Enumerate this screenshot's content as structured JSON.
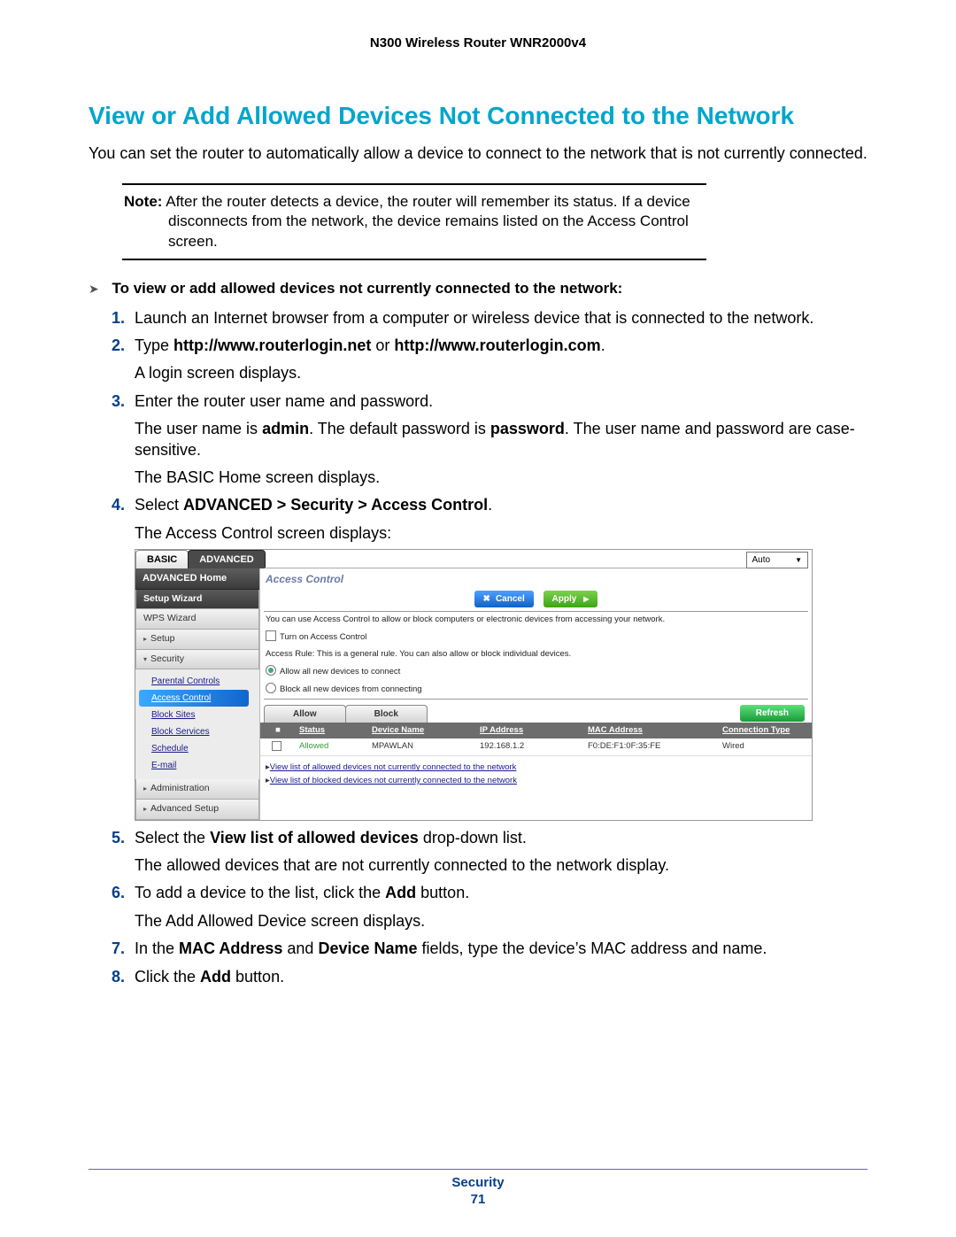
{
  "doc_header": "N300 Wireless Router WNR2000v4",
  "title": "View or Add Allowed Devices Not Connected to the Network",
  "intro": "You can set the router to automatically allow a device to connect to the network that is not currently connected.",
  "note": {
    "label": "Note:",
    "text": "After the router detects a device, the router will remember its status. If a device disconnects from the network, the device remains listed on the Access Control screen."
  },
  "procedure_title": "To view or add allowed devices not currently connected to the network:",
  "steps": {
    "s1": "Launch an Internet browser from a computer or wireless device that is connected to the network.",
    "s2_a": "Type ",
    "s2_b": "http://www.routerlogin.net",
    "s2_c": " or ",
    "s2_d": "http://www.routerlogin.com",
    "s2_e": ".",
    "s2_sub": "A login screen displays.",
    "s3": "Enter the router user name and password.",
    "s3_sub1": "The user name is admin. The default password is password. The user name and password are case-sensitive.",
    "s3_sub1_pre": "The user name is ",
    "s3_sub1_admin": "admin",
    "s3_sub1_mid": ". The default password is ",
    "s3_sub1_pw": "password",
    "s3_sub1_post": ". The user name and password are case-sensitive.",
    "s3_sub2": "The BASIC Home screen displays.",
    "s4_a": "Select ",
    "s4_b": "ADVANCED > Security > Access Control",
    "s4_c": ".",
    "s4_sub": "The Access Control screen displays:",
    "s5_a": "Select the ",
    "s5_b": "View list of allowed devices",
    "s5_c": " drop-down list.",
    "s5_sub": "The allowed devices that are not currently connected to the network display.",
    "s6_a": "To add a device to the list, click the ",
    "s6_b": "Add",
    "s6_c": " button.",
    "s6_sub": "The Add Allowed Device screen displays.",
    "s7_a": "In the ",
    "s7_b": "MAC Address",
    "s7_c": " and ",
    "s7_d": "Device Name",
    "s7_e": " fields, type the device’s MAC address and name.",
    "s8_a": "Click the ",
    "s8_b": "Add",
    "s8_c": " button."
  },
  "ui": {
    "tabs": {
      "basic": "BASIC",
      "advanced": "ADVANCED"
    },
    "lang": "Auto",
    "nav": {
      "adv_home": "ADVANCED Home",
      "setup_wizard": "Setup Wizard",
      "wps_wizard": "WPS Wizard",
      "setup": "Setup",
      "security": "Security",
      "security_items": {
        "parental": "Parental Controls",
        "access": "Access Control",
        "block_sites": "Block Sites",
        "block_services": "Block Services",
        "schedule": "Schedule",
        "email": "E-mail"
      },
      "administration": "Administration",
      "adv_setup": "Advanced Setup"
    },
    "panel": {
      "title": "Access Control",
      "cancel": "Cancel",
      "apply": "Apply",
      "desc": "You can use Access Control to allow or block computers or electronic devices from accessing your network.",
      "turn_on": "Turn on Access Control",
      "rule_label": "Access Rule: This is a general rule. You can also allow or block individual devices.",
      "allow_new": "Allow all new devices to connect",
      "block_new": "Block all new devices from connecting",
      "tab_allow": "Allow",
      "tab_block": "Block",
      "refresh": "Refresh",
      "cols": {
        "status": "Status",
        "name": "Device Name",
        "ip": "IP Address",
        "mac": "MAC Address",
        "conn": "Connection Type"
      },
      "row": {
        "status": "Allowed",
        "name": "MPAWLAN",
        "ip": "192.168.1.2",
        "mac": "F0:DE:F1:0F:35:FE",
        "conn": "Wired"
      },
      "link_allowed": "View list of allowed devices not currently connected to the network",
      "link_blocked": "View list of blocked devices not currently connected to the network"
    }
  },
  "footer": {
    "section": "Security",
    "page": "71"
  }
}
